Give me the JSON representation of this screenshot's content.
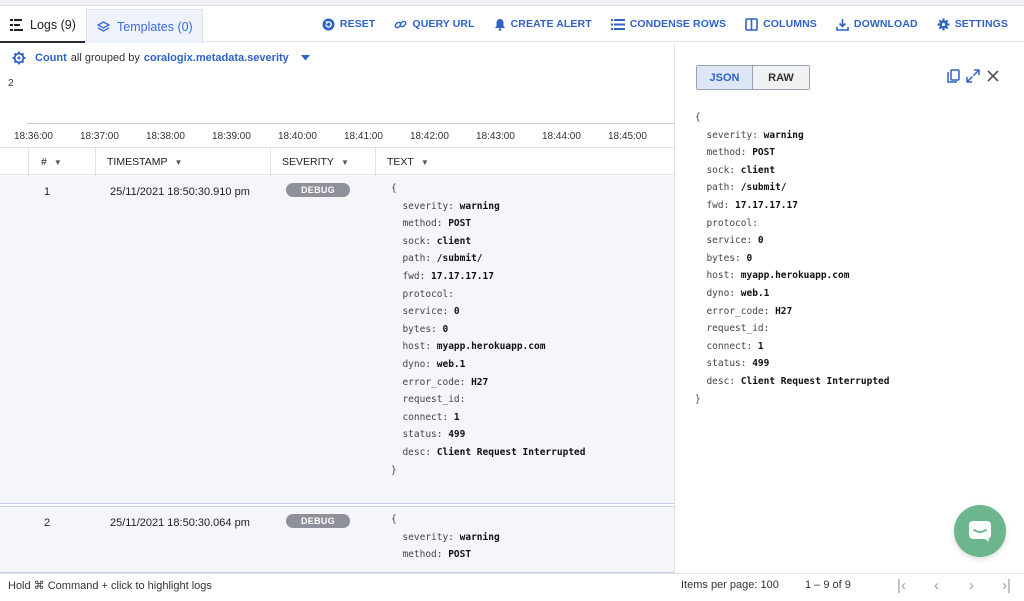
{
  "tabs": {
    "logs": "Logs (9)",
    "templates": "Templates (0)"
  },
  "actions": [
    {
      "icon": "reset-icon",
      "label": "RESET"
    },
    {
      "icon": "link-icon",
      "label": "QUERY URL"
    },
    {
      "icon": "bell-icon",
      "label": "CREATE ALERT"
    },
    {
      "icon": "condense-icon",
      "label": "CONDENSE ROWS"
    },
    {
      "icon": "columns-icon",
      "label": "COLUMNS"
    },
    {
      "icon": "download-icon",
      "label": "DOWNLOAD"
    },
    {
      "icon": "gear-icon",
      "label": "SETTINGS"
    }
  ],
  "groupbar": {
    "metric": "Count",
    "middle": "all grouped by",
    "field": "coralogix.metadata.severity"
  },
  "histogram": {
    "y_value": "2",
    "ticks": [
      "18:36:00",
      "18:37:00",
      "18:38:00",
      "18:39:00",
      "18:40:00",
      "18:41:00",
      "18:42:00",
      "18:43:00",
      "18:44:00",
      "18:45:00"
    ]
  },
  "columns": {
    "num": "#",
    "timestamp": "TIMESTAMP",
    "severity": "SEVERITY",
    "text": "TEXT"
  },
  "rows": [
    {
      "num": "1",
      "timestamp": "25/11/2021 18:50:30.910 pm",
      "severity": "DEBUG",
      "lines": [
        {
          "k": "{",
          "v": ""
        },
        {
          "k": "  severity: ",
          "v": "warning"
        },
        {
          "k": "  method: ",
          "v": "POST"
        },
        {
          "k": "  sock: ",
          "v": "client"
        },
        {
          "k": "  path: ",
          "v": "/submit/"
        },
        {
          "k": "  fwd: ",
          "v": "17.17.17.17"
        },
        {
          "k": "  protocol:",
          "v": ""
        },
        {
          "k": "  service: ",
          "v": "0"
        },
        {
          "k": "  bytes: ",
          "v": "0"
        },
        {
          "k": "  host: ",
          "v": "myapp.herokuapp.com"
        },
        {
          "k": "  dyno: ",
          "v": "web.1"
        },
        {
          "k": "  error_code: ",
          "v": "H27"
        },
        {
          "k": "  request_id:",
          "v": ""
        },
        {
          "k": "  connect: ",
          "v": "1"
        },
        {
          "k": "  status: ",
          "v": "499"
        },
        {
          "k": "  desc: ",
          "v": "Client Request Interrupted"
        },
        {
          "k": "}",
          "v": ""
        }
      ]
    },
    {
      "num": "2",
      "timestamp": "25/11/2021 18:50:30.064 pm",
      "severity": "DEBUG",
      "lines": [
        {
          "k": "{",
          "v": ""
        },
        {
          "k": "  severity: ",
          "v": "warning"
        },
        {
          "k": "  method: ",
          "v": "POST"
        }
      ]
    }
  ],
  "detail": {
    "json_label": "JSON",
    "raw_label": "RAW",
    "lines": [
      {
        "k": "{",
        "v": ""
      },
      {
        "k": "  severity: ",
        "v": "warning"
      },
      {
        "k": "  method: ",
        "v": "POST"
      },
      {
        "k": "  sock: ",
        "v": "client"
      },
      {
        "k": "  path: ",
        "v": "/submit/"
      },
      {
        "k": "  fwd: ",
        "v": "17.17.17.17"
      },
      {
        "k": "  protocol:",
        "v": ""
      },
      {
        "k": "  service: ",
        "v": "0"
      },
      {
        "k": "  bytes: ",
        "v": "0"
      },
      {
        "k": "  host: ",
        "v": "myapp.herokuapp.com"
      },
      {
        "k": "  dyno: ",
        "v": "web.1"
      },
      {
        "k": "  error_code: ",
        "v": "H27"
      },
      {
        "k": "  request_id:",
        "v": ""
      },
      {
        "k": "  connect: ",
        "v": "1"
      },
      {
        "k": "  status: ",
        "v": "499"
      },
      {
        "k": "  desc: ",
        "v": "Client Request Interrupted"
      },
      {
        "k": "}",
        "v": ""
      }
    ]
  },
  "footer": {
    "hint": "Hold ⌘ Command + click to highlight logs",
    "items_per_page": "Items per page: 100",
    "range": "1 – 9 of 9"
  },
  "colors": {
    "accent": "#2f62c7",
    "badge": "#8e9199",
    "chat": "#6db58c"
  }
}
